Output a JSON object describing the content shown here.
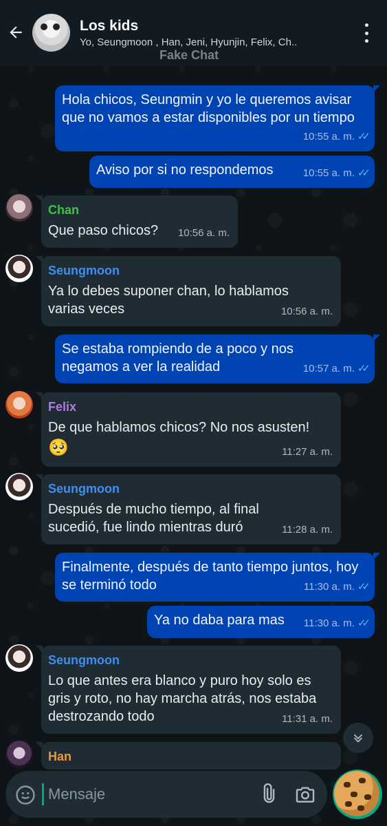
{
  "header": {
    "title": "Los kids",
    "subtitle": "Yo, Seungmoon , Han, Jeni, Hyunjin, Felix, Ch..",
    "watermark": "Fake Chat"
  },
  "messages": [
    {
      "type": "out",
      "text": "Hola chicos, Seungmin y yo le queremos avisar que no vamos a estar disponibles por un tiempo",
      "time": "10:55 a. m."
    },
    {
      "type": "out",
      "text": "Aviso por si no respondemos",
      "time": "10:55 a. m."
    },
    {
      "type": "in",
      "sender": "Chan",
      "text": "Que paso chicos?",
      "time": "10:56 a. m."
    },
    {
      "type": "in",
      "sender": "Seungmoon",
      "text": "Ya lo debes suponer chan, lo hablamos varias veces",
      "time": "10:56 a. m."
    },
    {
      "type": "out",
      "text": "Se estaba rompiendo de a poco y nos negamos a ver la realidad",
      "time": "10:57 a. m."
    },
    {
      "type": "in",
      "sender": "Felix",
      "text": "De que hablamos chicos? No nos asusten!",
      "emoji": "🥺",
      "time": "11:27 a. m."
    },
    {
      "type": "in",
      "sender": "Seungmoon",
      "text": "Después de mucho tiempo, al final sucedió, fue lindo mientras duró",
      "time": "11:28 a. m."
    },
    {
      "type": "out",
      "text": "Finalmente, después de tanto tiempo juntos, hoy se terminó todo",
      "time": "11:30 a. m."
    },
    {
      "type": "out",
      "text": "Ya no daba para mas",
      "time": "11:30 a. m."
    },
    {
      "type": "in",
      "sender": "Seungmoon",
      "text": "Lo que antes era blanco y puro hoy solo es gris y roto, no hay marcha atrás, nos estaba destrozando todo",
      "time": "11:31 a. m."
    },
    {
      "type": "in",
      "sender": "Han",
      "text": "",
      "time": ""
    }
  ],
  "ticks": "✓✓",
  "colors": {
    "chan": "#3ec43e",
    "seungmoon": "#3f8ef0",
    "felix": "#b27adf",
    "han": "#f0973a",
    "outgoing_bubble": "#0044b3",
    "incoming_bubble": "#1f2c33",
    "read_ticks": "#53bdeb"
  },
  "input": {
    "placeholder": "Mensaje"
  },
  "icons": {
    "back": "arrow-left-icon",
    "menu": "more-vertical-icon",
    "scroll": "chevron-down-icon",
    "emoji": "smiley-icon",
    "attach": "paperclip-icon",
    "camera": "camera-icon",
    "send": "cookie-sticker-icon"
  }
}
